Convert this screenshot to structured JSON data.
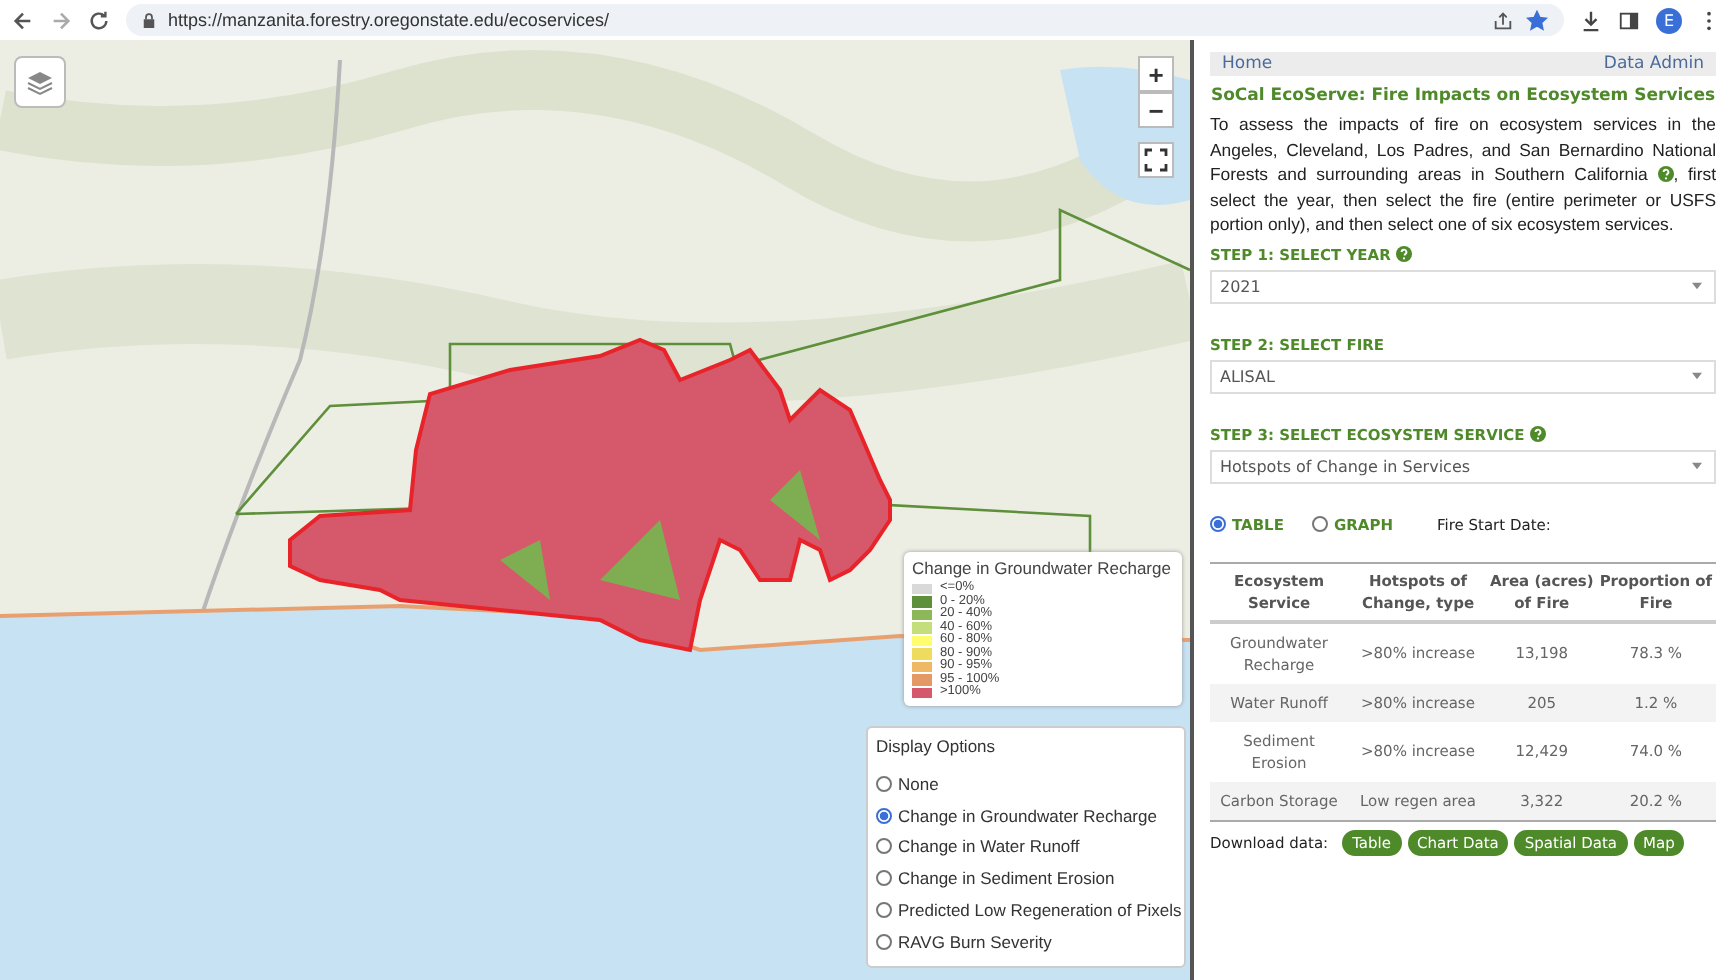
{
  "browser": {
    "url": "https://manzanita.forestry.oregonstate.edu/ecoservices/",
    "bookmarked": true,
    "profile_initial": "E"
  },
  "map": {
    "zoom_in": "+",
    "zoom_out": "−",
    "legend": {
      "title": "Change in Groundwater Recharge",
      "items": [
        {
          "label": "<=0%",
          "color": "#d9d9d9"
        },
        {
          "label": "0 - 20%",
          "color": "#5e8f3a"
        },
        {
          "label": "20 - 40%",
          "color": "#8cb85a"
        },
        {
          "label": "40 - 60%",
          "color": "#c3de7a"
        },
        {
          "label": "60 - 80%",
          "color": "#fdfd6e"
        },
        {
          "label": "80 - 90%",
          "color": "#efdc5e"
        },
        {
          "label": "90 - 95%",
          "color": "#efb865"
        },
        {
          "label": "95 - 100%",
          "color": "#e39866"
        },
        {
          "label": ">100%",
          "color": "#d5596b"
        }
      ]
    },
    "display_options": {
      "title": "Display Options",
      "options": [
        {
          "label": "None",
          "selected": false
        },
        {
          "label": "Change in Groundwater Recharge",
          "selected": true
        },
        {
          "label": "Change in Water Runoff",
          "selected": false
        },
        {
          "label": "Change in Sediment Erosion",
          "selected": false
        },
        {
          "label": "Predicted Low Regeneration of Pixels",
          "selected": false
        },
        {
          "label": "RAVG Burn Severity",
          "selected": false
        }
      ]
    }
  },
  "panel": {
    "nav": [
      "Home",
      "Data Admin"
    ],
    "title": "SoCal EcoServe: Fire Impacts on Ecosystem Services",
    "intro": [
      "To assess the impacts of fire on ecosystem services in the Angeles, Cleveland, Los Padres, and San Bernardino National Forests and surrounding areas in Southern California",
      ", first select the year, then select the fire (entire perimeter or USFS portion only), and then select one of six ecosystem services."
    ],
    "steps": [
      {
        "label": "STEP 1: SELECT YEAR",
        "help": true,
        "value": "2021"
      },
      {
        "label": "STEP 2: SELECT FIRE",
        "help": false,
        "value": "ALISAL"
      },
      {
        "label": "STEP 3: SELECT ECOSYSTEM SERVICE",
        "help": true,
        "value": "Hotspots of Change in Services"
      }
    ],
    "view_options": [
      {
        "label": "TABLE",
        "selected": true
      },
      {
        "label": "GRAPH",
        "selected": false
      }
    ],
    "fire_start_label": "Fire Start Date:",
    "table": {
      "columns": [
        "Ecosystem Service",
        "Hotspots of Change, type",
        "Area (acres) of Fire",
        "Proportion of Fire"
      ],
      "rows": [
        [
          "Groundwater Recharge",
          ">80% increase",
          "13,198",
          "78.3 %"
        ],
        [
          "Water Runoff",
          ">80% increase",
          "205",
          "1.2 %"
        ],
        [
          "Sediment Erosion",
          ">80% increase",
          "12,429",
          "74.0 %"
        ],
        [
          "Carbon Storage",
          "Low regen area",
          "3,322",
          "20.2 %"
        ]
      ]
    },
    "download": {
      "label": "Download data:",
      "buttons": [
        "Table",
        "Chart Data",
        "Spatial Data",
        "Map"
      ]
    }
  }
}
